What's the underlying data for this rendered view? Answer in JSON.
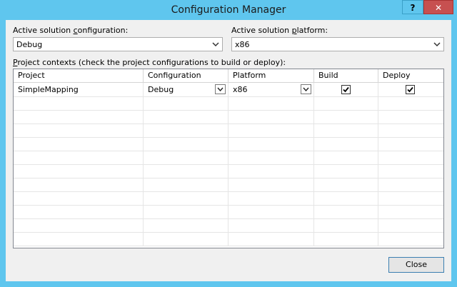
{
  "window": {
    "title": "Configuration Manager",
    "help_label": "?",
    "close_label": "✕"
  },
  "active_solution_configuration": {
    "label_pre": "Active solution ",
    "label_key": "c",
    "label_post": "onfiguration:",
    "value": "Debug"
  },
  "active_solution_platform": {
    "label_pre": "Active solution ",
    "label_key": "p",
    "label_post": "latform:",
    "value": "x86"
  },
  "project_contexts": {
    "label_key": "P",
    "label_post": "roject contexts (check the project configurations to build or deploy):"
  },
  "grid": {
    "columns": [
      "Project",
      "Configuration",
      "Platform",
      "Build",
      "Deploy"
    ],
    "rows": [
      {
        "project": "SimpleMapping",
        "configuration": "Debug",
        "platform": "x86",
        "build": true,
        "deploy": true
      }
    ]
  },
  "footer": {
    "close_label": "Close"
  }
}
